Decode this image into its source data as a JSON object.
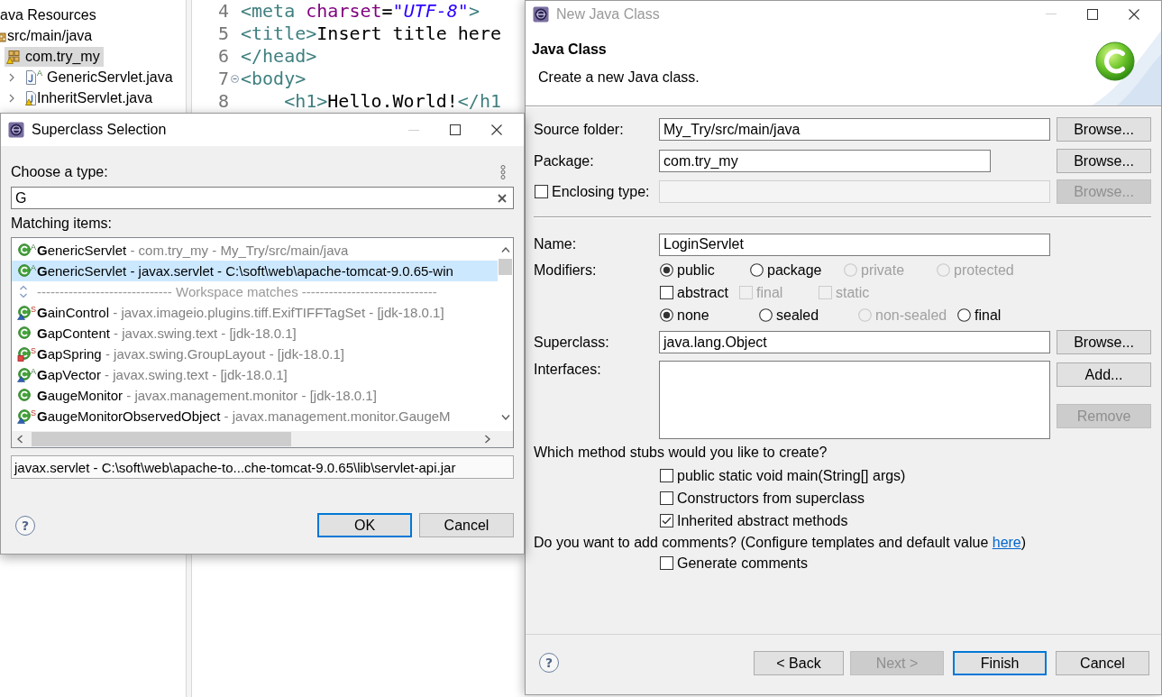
{
  "explorer": {
    "tree": [
      {
        "label": "ava Resources",
        "selected": false,
        "children": [
          {
            "label": "src/main/java",
            "kind": "source-folder",
            "selected": false,
            "warning": false,
            "children": [
              {
                "label": "com.try_my",
                "kind": "package",
                "selected": true,
                "warning": true,
                "children": [
                  {
                    "label": "GenericServlet.java",
                    "kind": "java-file",
                    "badge": "A",
                    "selected": false,
                    "warning": false,
                    "expanded": false
                  },
                  {
                    "label": "InheritServlet.java",
                    "kind": "java-file",
                    "selected": false,
                    "warning": true,
                    "expanded": false
                  }
                ]
              }
            ]
          }
        ]
      }
    ]
  },
  "editor": {
    "lines": [
      {
        "number": "4",
        "folding": false,
        "indented": false,
        "segments": [
          {
            "kind": "tag",
            "text": "<meta"
          },
          {
            "kind": "attr",
            "text": " charset"
          },
          {
            "kind": "text",
            "text": "="
          },
          {
            "kind": "string",
            "text": "\"UTF-8\""
          },
          {
            "kind": "tag",
            "text": ">"
          }
        ]
      },
      {
        "number": "5",
        "folding": false,
        "indented": false,
        "segments": [
          {
            "kind": "tag",
            "text": "<title>"
          },
          {
            "kind": "text",
            "text": "Insert title here"
          }
        ]
      },
      {
        "number": "6",
        "folding": false,
        "indented": false,
        "segments": [
          {
            "kind": "tag",
            "text": "</head>"
          }
        ]
      },
      {
        "number": "7",
        "folding": true,
        "indented": false,
        "segments": [
          {
            "kind": "tag",
            "text": "<body>"
          }
        ]
      },
      {
        "number": "8",
        "folding": false,
        "indented": true,
        "segments": [
          {
            "kind": "tag",
            "text": "<h1>"
          },
          {
            "kind": "text",
            "text": "Hello.World!"
          },
          {
            "kind": "tag",
            "text": "</h1"
          }
        ]
      }
    ]
  },
  "superclass_dialog": {
    "title": "Superclass Selection",
    "active": true,
    "prompt": "Choose a type:",
    "search": {
      "value": "G"
    },
    "list_label": "Matching items:",
    "items": [
      {
        "kind": "type",
        "name": "**G**enericServlet",
        "qualifier": " - com.try_my - My_Try/src/main/java",
        "badge": {
          "text": "A",
          "kind": "abstract"
        },
        "default_access": false,
        "private_access": false,
        "selected": false
      },
      {
        "kind": "type",
        "name": "**G**enericServlet",
        "qualifier": " - javax.servlet - C:\\soft\\web\\apache-tomcat-9.0.65-win",
        "badge": {
          "text": "A",
          "kind": "abstract"
        },
        "default_access": false,
        "private_access": false,
        "selected": true
      },
      {
        "kind": "separator",
        "label": "------------------------------ Workspace matches ------------------------------",
        "selected": false
      },
      {
        "kind": "type",
        "name": "**G**ainControl",
        "qualifier": " - javax.imageio.plugins.tiff.ExifTIFFTagSet - [jdk-18.0.1]",
        "badge": {
          "text": "S",
          "kind": "static"
        },
        "default_access": true,
        "private_access": false,
        "selected": false
      },
      {
        "kind": "type",
        "name": "**G**apContent",
        "qualifier": " - javax.swing.text - [jdk-18.0.1]",
        "default_access": false,
        "private_access": false,
        "selected": false
      },
      {
        "kind": "type",
        "name": "**G**apSpring",
        "qualifier": " - javax.swing.GroupLayout - [jdk-18.0.1]",
        "badge": {
          "text": "S",
          "kind": "static"
        },
        "default_access": false,
        "private_access": true,
        "selected": false
      },
      {
        "kind": "type",
        "name": "**G**apVector",
        "qualifier": " - javax.swing.text - [jdk-18.0.1]",
        "badge": {
          "text": "A",
          "kind": "abstract"
        },
        "default_access": true,
        "private_access": false,
        "selected": false
      },
      {
        "kind": "type",
        "name": "**G**augeMonitor",
        "qualifier": " - javax.management.monitor - [jdk-18.0.1]",
        "default_access": false,
        "private_access": false,
        "selected": false
      },
      {
        "kind": "type",
        "name": "**G**augeMonitorObservedObject",
        "qualifier": " - javax.management.monitor.GaugeM",
        "badge": {
          "text": "S",
          "kind": "static"
        },
        "default_access": true,
        "private_access": false,
        "selected": false
      }
    ],
    "details": "javax.servlet - C:\\soft\\web\\apache-to...che-tomcat-9.0.65\\lib\\servlet-api.jar",
    "help": "?",
    "buttons": [
      {
        "label": "OK",
        "focused": true
      },
      {
        "label": "Cancel",
        "focused": false
      }
    ]
  },
  "new_class_dialog": {
    "title": "New Java Class",
    "active": false,
    "heading": "Java Class",
    "description": "Create a new Java class.",
    "fields": [
      {
        "kind": "text",
        "label": "Source folder:",
        "value": "My_Try/src/main/java",
        "disabled": false,
        "button": {
          "label": "Browse...",
          "disabled": false
        }
      },
      {
        "kind": "short",
        "label": "Package:",
        "value": "com.try_my",
        "disabled": false,
        "button": {
          "label": "Browse...",
          "disabled": false
        }
      },
      {
        "kind": "checkbox",
        "label": "Enclosing type:",
        "checked": false,
        "disabled": true,
        "button": {
          "label": "Browse...",
          "disabled": true
        }
      }
    ],
    "name": {
      "label": "Name:",
      "value": "LoginServlet"
    },
    "modifiers": {
      "label": "Modifiers:",
      "access": [
        {
          "label": "public",
          "selected": true,
          "disabled": false
        },
        {
          "label": "package",
          "selected": false,
          "disabled": false
        },
        {
          "label": "private",
          "selected": false,
          "disabled": true
        },
        {
          "label": "protected",
          "selected": false,
          "disabled": true
        }
      ],
      "flags": [
        {
          "label": "abstract",
          "checked": false,
          "disabled": false
        },
        {
          "label": "final",
          "checked": false,
          "disabled": true
        },
        {
          "label": "static",
          "checked": false,
          "disabled": true
        }
      ],
      "sealing": [
        {
          "label": "none",
          "selected": true,
          "disabled": false
        },
        {
          "label": "sealed",
          "selected": false,
          "disabled": false
        },
        {
          "label": "non-sealed",
          "selected": false,
          "disabled": true
        },
        {
          "label": "final",
          "selected": false,
          "disabled": false
        }
      ]
    },
    "superclass": {
      "label": "Superclass:",
      "value": "java.lang.Object",
      "button": {
        "label": "Browse...",
        "disabled": false
      }
    },
    "interfaces": {
      "label": "Interfaces:",
      "buttons": [
        {
          "label": "Add...",
          "disabled": false
        },
        {
          "label": "Remove",
          "disabled": true
        }
      ]
    },
    "stubs": {
      "question": "Which method stubs would you like to create?",
      "options": [
        {
          "label": "public static void main(String[] args)",
          "checked": false
        },
        {
          "label": "Constructors from superclass",
          "checked": false
        },
        {
          "label": "Inherited abstract methods",
          "checked": true
        }
      ]
    },
    "comments": {
      "question": "Do you want to add comments? (Configure templates and default value ",
      "link": "here",
      "question_end": ")",
      "option": {
        "label": "Generate comments",
        "checked": false
      }
    },
    "help": "?",
    "buttons": [
      {
        "label": "< Back",
        "disabled": false,
        "focused": false
      },
      {
        "label": "Next >",
        "disabled": true,
        "focused": false
      },
      {
        "label": "Finish",
        "disabled": false,
        "focused": true
      },
      {
        "label": "Cancel",
        "disabled": false,
        "focused": false
      }
    ]
  }
}
